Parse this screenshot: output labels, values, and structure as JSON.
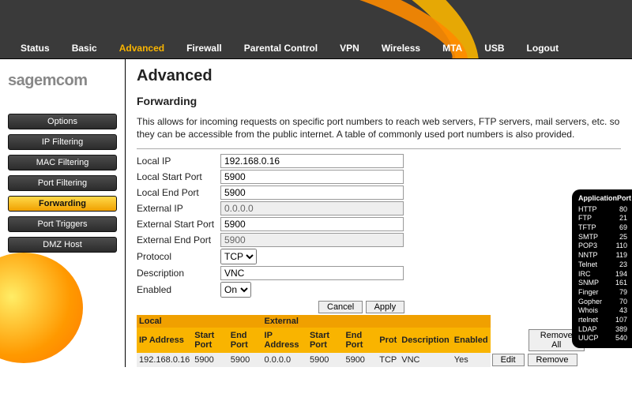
{
  "nav": [
    "Status",
    "Basic",
    "Advanced",
    "Firewall",
    "Parental Control",
    "VPN",
    "Wireless",
    "MTA",
    "USB",
    "Logout"
  ],
  "nav_active_index": 2,
  "brand": "sagemcom",
  "sidebar": {
    "items": [
      {
        "label": "Options"
      },
      {
        "label": "IP Filtering"
      },
      {
        "label": "MAC Filtering"
      },
      {
        "label": "Port Filtering"
      },
      {
        "label": "Forwarding"
      },
      {
        "label": "Port Triggers"
      },
      {
        "label": "DMZ Host"
      }
    ],
    "active_index": 4
  },
  "page": {
    "h1": "Advanced",
    "h2": "Forwarding",
    "intro": "This allows for incoming requests on specific port numbers to reach web servers, FTP servers, mail servers, etc. so they can be accessible from the public internet. A table of commonly used port numbers is also provided."
  },
  "form": {
    "labels": {
      "local_ip": "Local IP",
      "local_start": "Local Start Port",
      "local_end": "Local End Port",
      "ext_ip": "External IP",
      "ext_start": "External Start Port",
      "ext_end": "External End Port",
      "protocol": "Protocol",
      "description": "Description",
      "enabled": "Enabled"
    },
    "values": {
      "local_ip": "192.168.0.16",
      "local_start": "5900",
      "local_end": "5900",
      "ext_ip": "0.0.0.0",
      "ext_start": "5900",
      "ext_end": "5900",
      "protocol": "TCP",
      "description": "VNC",
      "enabled": "On"
    },
    "buttons": {
      "cancel": "Cancel",
      "apply": "Apply"
    }
  },
  "table": {
    "sections": {
      "local": "Local",
      "external": "External"
    },
    "headers": {
      "ip": "IP Address",
      "sp": "Start Port",
      "ep": "End Port",
      "prot": "Prot",
      "desc": "Description",
      "en": "Enabled"
    },
    "remove_all": "Remove All",
    "edit": "Edit",
    "remove": "Remove",
    "rows": [
      {
        "lip": "192.168.0.16",
        "lsp": "5900",
        "lep": "5900",
        "xip": "0.0.0.0",
        "xsp": "5900",
        "xep": "5900",
        "prot": "TCP",
        "desc": "VNC",
        "en": "Yes"
      }
    ]
  },
  "portref": {
    "head_app": "Application",
    "head_port": "Port",
    "rows": [
      {
        "a": "HTTP",
        "p": "80"
      },
      {
        "a": "FTP",
        "p": "21"
      },
      {
        "a": "TFTP",
        "p": "69"
      },
      {
        "a": "SMTP",
        "p": "25"
      },
      {
        "a": "POP3",
        "p": "110"
      },
      {
        "a": "NNTP",
        "p": "119"
      },
      {
        "a": "Telnet",
        "p": "23"
      },
      {
        "a": "IRC",
        "p": "194"
      },
      {
        "a": "SNMP",
        "p": "161"
      },
      {
        "a": "Finger",
        "p": "79"
      },
      {
        "a": "Gopher",
        "p": "70"
      },
      {
        "a": "Whois",
        "p": "43"
      },
      {
        "a": "rtelnet",
        "p": "107"
      },
      {
        "a": "LDAP",
        "p": "389"
      },
      {
        "a": "UUCP",
        "p": "540"
      }
    ]
  }
}
